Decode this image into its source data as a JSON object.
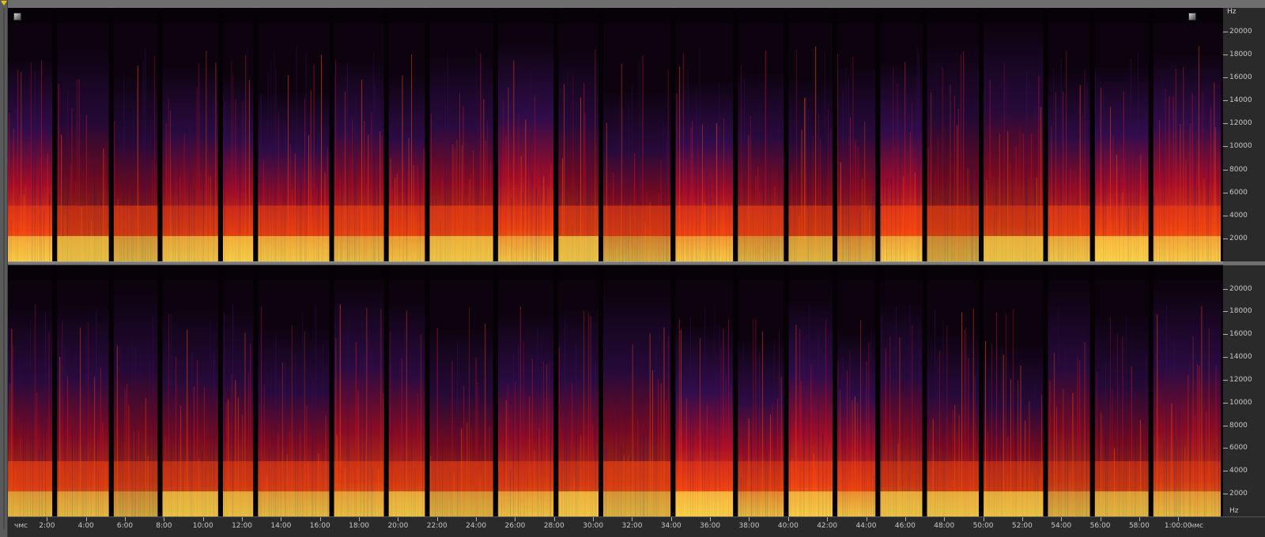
{
  "spectrogram": {
    "units": {
      "freq_top": "Hz",
      "freq_bottom": "Hz",
      "time_left": "чмс",
      "time_right": "чмс"
    },
    "freq_labels": [
      "20000",
      "18000",
      "16000",
      "14000",
      "12000",
      "10000",
      "8000",
      "6000",
      "4000",
      "2000"
    ],
    "freq_max_hz": 22050,
    "time_labels": [
      "2:00",
      "4:00",
      "6:00",
      "8:00",
      "10:00",
      "12:00",
      "14:00",
      "16:00",
      "18:00",
      "20:00",
      "22:00",
      "24:00",
      "26:00",
      "28:00",
      "30:00",
      "32:00",
      "34:00",
      "36:00",
      "38:00",
      "40:00",
      "42:00",
      "44:00",
      "46:00",
      "48:00",
      "50:00",
      "52:00",
      "54:00",
      "56:00",
      "58:00",
      "1:00:00"
    ],
    "time_total_min": 62.3,
    "track_gaps_min": [
      2.4,
      5.3,
      7.8,
      10.9,
      12.7,
      16.6,
      19.4,
      21.5,
      25.0,
      28.1,
      30.4,
      34.1,
      37.3,
      39.9,
      42.4,
      44.6,
      47.0,
      49.9,
      53.2,
      55.6,
      58.6
    ],
    "colors": {
      "background": "#0c030f",
      "low": "#3a0f5a",
      "mid": "#c8102e",
      "high": "#ff4a10",
      "peak": "#ffd94a"
    }
  },
  "controls": {
    "scroll_marker": "scroll-marker-icon",
    "corner_left": "zoom-corner-icon",
    "corner_right": "zoom-corner-icon"
  }
}
